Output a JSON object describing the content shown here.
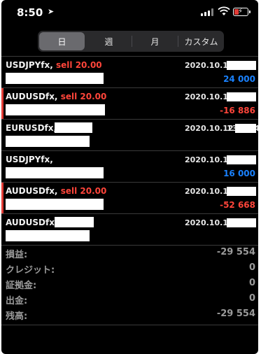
{
  "status": {
    "time": "8:50"
  },
  "tabs": [
    "日",
    "週",
    "月",
    "カスタム"
  ],
  "trades": [
    {
      "symbol": "USDJPYfx,",
      "side": "sell 20.00",
      "date": "2020.10.12",
      "pnl": "24 000",
      "sign": "pos",
      "bar": false
    },
    {
      "symbol": "AUDUSDfx,",
      "side": "sell 20.00",
      "date": "2020.10.12",
      "pnl": "-16 886",
      "sign": "neg",
      "bar": true
    },
    {
      "symbol": "EURUSDfx,",
      "side": "",
      "date": "2020.10.12",
      "pnl": "",
      "sign": "",
      "bar": false,
      "tail": "13:09:49"
    },
    {
      "symbol": "USDJPYfx,",
      "side": "",
      "date": "2020.10.12",
      "pnl": "16 000",
      "sign": "pos",
      "bar": false
    },
    {
      "symbol": "AUDUSDfx,",
      "side": "sell 20.00",
      "date": "2020.10.12",
      "pnl": "-52 668",
      "sign": "neg",
      "bar": true
    },
    {
      "symbol": "AUDUSDfx,",
      "side": "",
      "date": "2020.10.12",
      "pnl": "",
      "sign": "",
      "bar": false
    }
  ],
  "summary": [
    {
      "label": "損益:",
      "value": "-29 554"
    },
    {
      "label": "クレジット:",
      "value": "0"
    },
    {
      "label": "証拠金:",
      "value": "0"
    },
    {
      "label": "出金:",
      "value": "0"
    },
    {
      "label": "残高:",
      "value": "-29 554"
    }
  ],
  "colors": {
    "sell": "#ff453a",
    "positive": "#1a82ff",
    "negative": "#ff453a",
    "background": "#000000"
  }
}
